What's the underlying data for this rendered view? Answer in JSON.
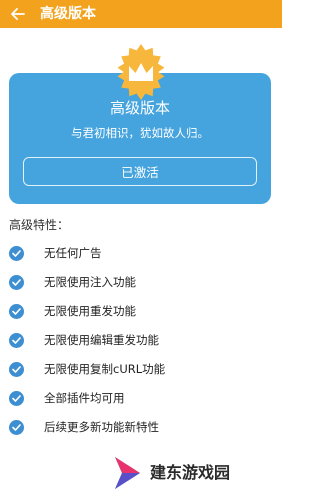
{
  "header": {
    "title": "高级版本",
    "back_icon": "arrow-left-icon",
    "background_color": "#f2a21c"
  },
  "card": {
    "title": "高级版本",
    "subtitle": "与君初相识，犹如故人归。",
    "button_label": "已激活",
    "badge_icon": "crown-badge-icon",
    "background_color": "#45a3dd",
    "badge_color": "#f6b73c"
  },
  "features": {
    "title": "高级特性：",
    "check_icon": "check-circle-icon",
    "check_color": "#3d8fd2",
    "items": [
      "无任何广告",
      "无限使用注入功能",
      "无限使用重发功能",
      "无限使用编辑重发功能",
      "无限使用复制cURL功能",
      "全部插件均可用",
      "后续更多新功能新特性"
    ]
  },
  "watermark": {
    "text": "建东游戏园",
    "logo_icon": "play-logo-icon"
  }
}
